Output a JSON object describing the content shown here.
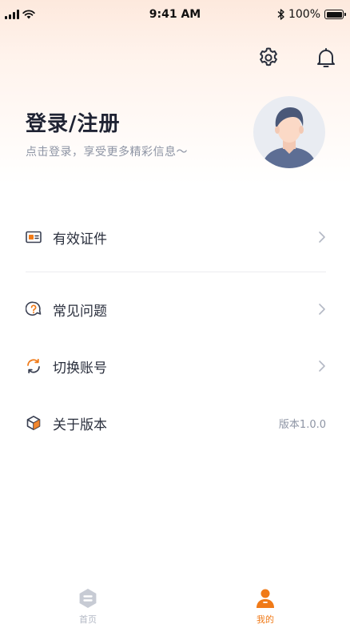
{
  "status_bar": {
    "time": "9:41 AM",
    "battery": "100%"
  },
  "header": {
    "settings_icon": "gear-icon",
    "notification_icon": "bell-icon"
  },
  "profile": {
    "title": "登录/注册",
    "subtitle": "点击登录，享受更多精彩信息～",
    "avatar_icon": "default-male-avatar"
  },
  "menu": {
    "items": [
      {
        "label": "有效证件",
        "icon": "id-card-icon",
        "trailing": "chevron"
      },
      {
        "label": "常见问题",
        "icon": "help-question-icon",
        "trailing": "chevron"
      },
      {
        "label": "切换账号",
        "icon": "switch-account-icon",
        "trailing": "chevron"
      },
      {
        "label": "关于版本",
        "icon": "cube-icon",
        "trailing": "版本1.0.0"
      }
    ]
  },
  "tab_bar": {
    "tabs": [
      {
        "label": "首页",
        "icon": "home-icon",
        "active": false
      },
      {
        "label": "我的",
        "icon": "user-icon",
        "active": true
      }
    ]
  },
  "colors": {
    "accent": "#f07a18",
    "text_primary": "#1f2333",
    "text_secondary": "#8d94a4",
    "tab_inactive": "#b3b8c4",
    "header_gradient": "#fde9dd"
  }
}
